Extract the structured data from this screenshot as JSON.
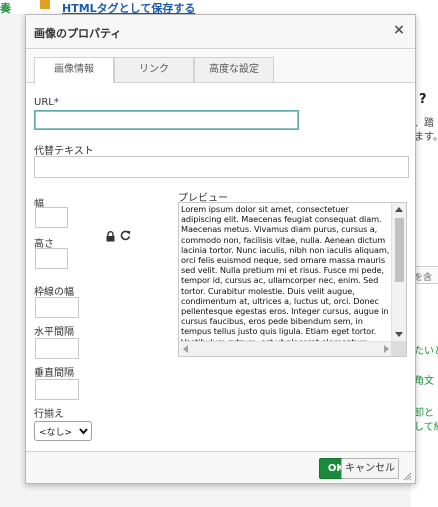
{
  "background": {
    "top_left_text": "奏",
    "top_link": "HTMLタグとして保存する",
    "right_q": "?",
    "right_line1": "、踏",
    "right_line2": "ます。",
    "right_box": "を含",
    "right_green1": "たいと",
    "right_green2": "角文",
    "right_green3": "卸と",
    "right_green4": "して維"
  },
  "dialog": {
    "title": "画像のプロパティ",
    "close_symbol": "×",
    "tabs": [
      {
        "label": "画像情報",
        "active": true
      },
      {
        "label": "リンク",
        "active": false
      },
      {
        "label": "高度な設定",
        "active": false
      }
    ],
    "url_label": "URL*",
    "url_value": "",
    "alt_label": "代替テキスト",
    "alt_value": "",
    "width_label": "幅",
    "width_value": "",
    "height_label": "高さ",
    "height_value": "",
    "border_label": "枠線の幅",
    "border_value": "",
    "hspace_label": "水平間隔",
    "hspace_value": "",
    "vspace_label": "垂直間隔",
    "vspace_value": "",
    "align_label": "行揃え",
    "align_value": "<なし>",
    "preview_label": "プレビュー",
    "preview_text": "Lorem ipsum dolor sit amet, consectetuer adipiscing elit. Maecenas feugiat consequat diam. Maecenas metus. Vivamus diam purus, cursus a, commodo non, facilisis vitae, nulla. Aenean dictum lacinia tortor. Nunc iaculis, nibh non iaculis aliquam, orci felis euismod neque, sed ornare massa mauris sed velit. Nulla pretium mi et risus. Fusce mi pede, tempor id, cursus ac, ullamcorper nec, enim. Sed tortor. Curabitur molestie. Duis velit augue, condimentum at, ultrices a, luctus ut, orci. Donec pellentesque egestas eros. Integer cursus, augue in cursus faucibus, eros pede bibendum sem, in tempus tellus justo quis ligula. Etiam eget tortor. Vestibulum rutrum, est ut placerat elementum,",
    "ok_label": "OK",
    "cancel_label": "キャンセル"
  },
  "colors": {
    "ok_button": "#1b8a3a",
    "focus_border": "#66a5a9",
    "link_blue": "#1a5dab",
    "green_text": "#1e8e3e"
  },
  "icons": [
    "lock-icon",
    "reset-icon",
    "close-icon",
    "chevron-down-icon",
    "resize-grip-icon"
  ]
}
